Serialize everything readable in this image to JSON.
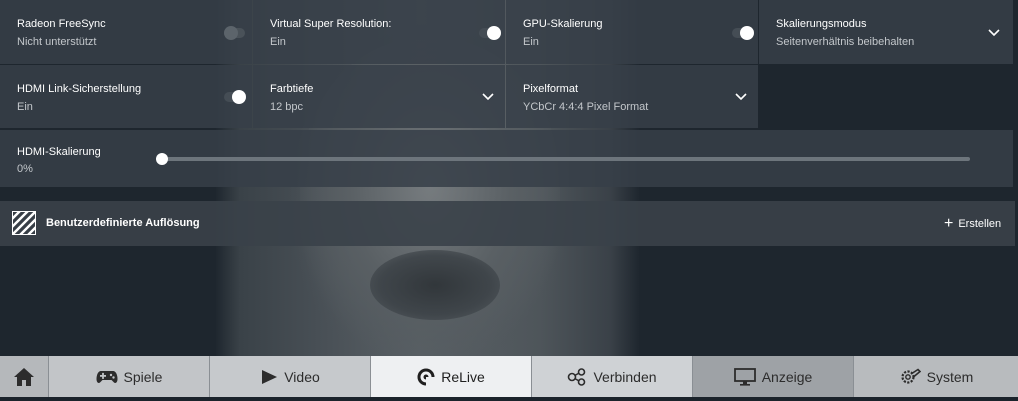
{
  "tiles": {
    "freesync": {
      "label": "Radeon FreeSync",
      "value": "Nicht unterstützt",
      "toggle": "off"
    },
    "vsr": {
      "label": "Virtual Super Resolution:",
      "value": "Ein",
      "toggle": "on"
    },
    "gpu_scaling": {
      "label": "GPU-Skalierung",
      "value": "Ein",
      "toggle": "on"
    },
    "scaling_mode": {
      "label": "Skalierungsmodus",
      "value": "Seitenverhältnis beibehalten"
    },
    "hdmi_link": {
      "label": "HDMI Link-Sicherstellung",
      "value": "Ein",
      "toggle": "on"
    },
    "color_depth": {
      "label": "Farbtiefe",
      "value": "12 bpc"
    },
    "pixel_format": {
      "label": "Pixelformat",
      "value": "YCbCr 4:4:4 Pixel Format"
    }
  },
  "hdmi_scaling": {
    "label": "HDMI-Skalierung",
    "value": "0%",
    "level": 0
  },
  "custom_resolution": {
    "title": "Benutzerdefinierte Auflösung",
    "create_label": "Erstellen",
    "create_icon": "plus-icon"
  },
  "nav": {
    "home_icon": "home-icon",
    "items": [
      {
        "label": "Spiele",
        "icon": "gamepad-icon"
      },
      {
        "label": "Video",
        "icon": "play-icon"
      },
      {
        "label": "ReLive",
        "icon": "relive-icon"
      },
      {
        "label": "Verbinden",
        "icon": "share-icon"
      },
      {
        "label": "Anzeige",
        "icon": "monitor-icon"
      },
      {
        "label": "System",
        "icon": "gear-wrench-icon"
      }
    ],
    "active": "ReLive"
  },
  "colors": {
    "tile_bg": "#373f48",
    "nav_active": "#eef0f2",
    "nav_inactive": "#c2c5c8",
    "text": "#ffffff",
    "subtext": "#c3c7cb"
  }
}
